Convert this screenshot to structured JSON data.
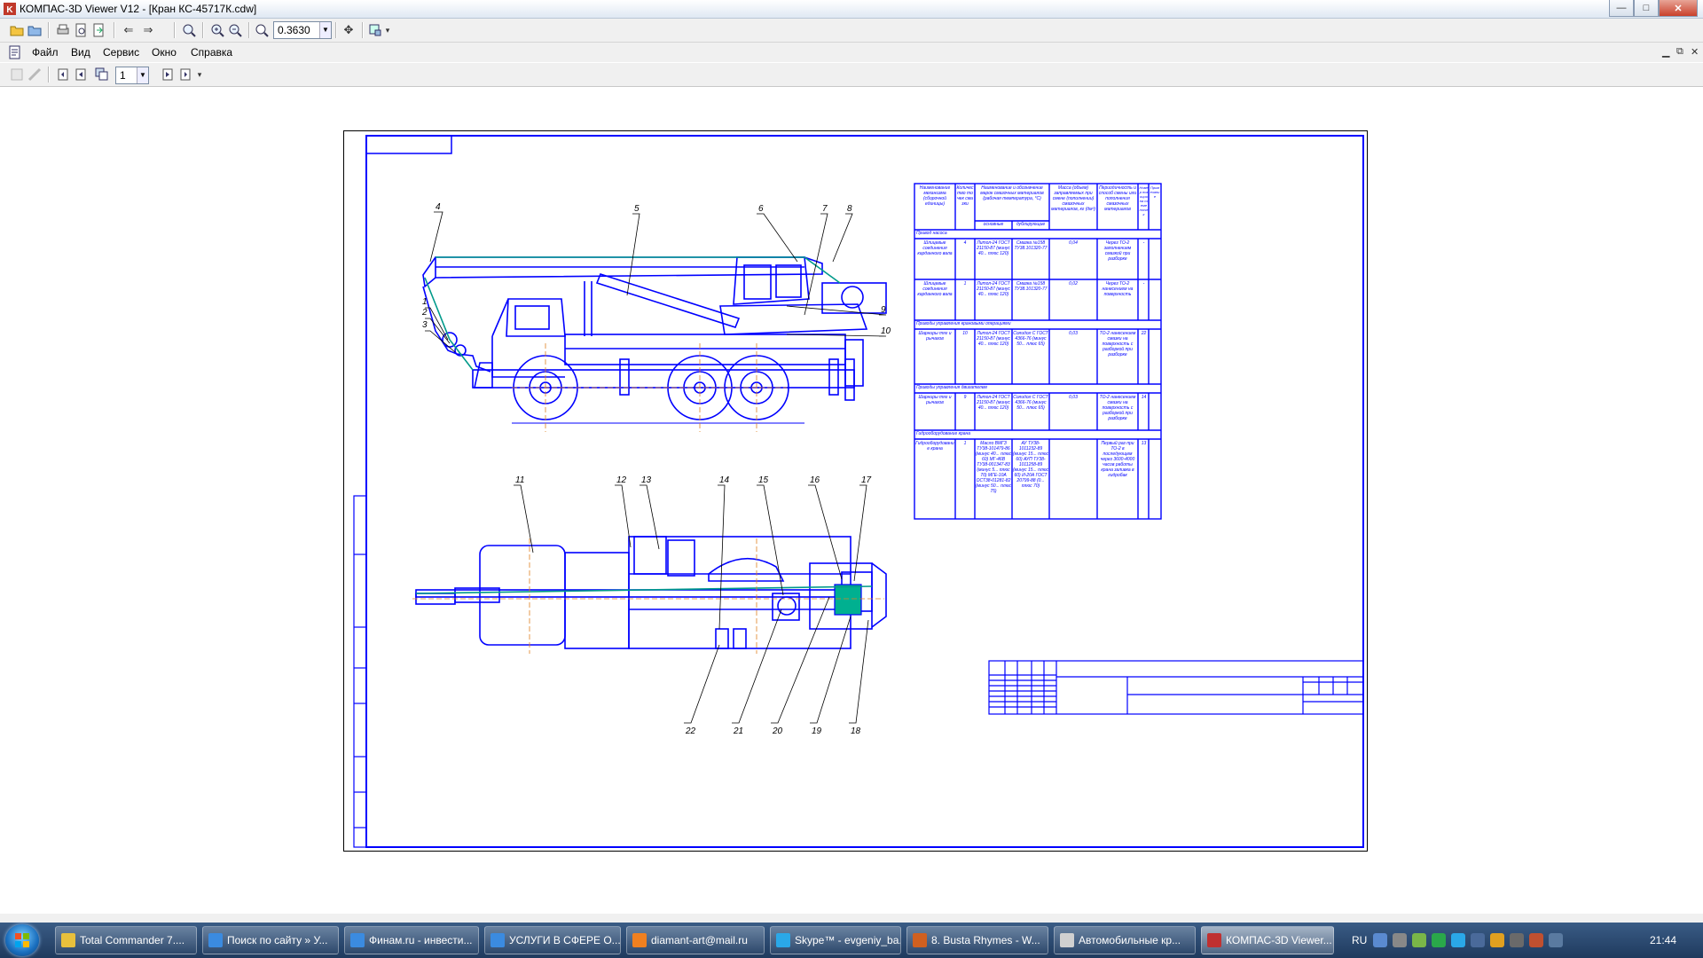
{
  "window": {
    "title": "КОМПАС-3D Viewer V12 - [Кран КС-45717К.cdw]"
  },
  "toolbar": {
    "zoom_value": "0.3630",
    "icons": [
      "open-icon",
      "open-folder-icon",
      "print-icon",
      "print-preview-icon",
      "export-icon",
      "back-arrow-icon",
      "forward-arrow-icon",
      "zoom-window-icon",
      "zoom-in-icon",
      "zoom-out-icon",
      "zoom-scale-icon",
      "pan-icon",
      "refresh-icon"
    ]
  },
  "menu": {
    "items": [
      "Файл",
      "Вид",
      "Сервис",
      "Окно",
      "Справка"
    ]
  },
  "toolbar2": {
    "page_value": "1"
  },
  "drawing": {
    "callouts_top": [
      "1",
      "2",
      "3",
      "4",
      "5",
      "6",
      "7",
      "8",
      "9",
      "10"
    ],
    "callouts_bottom": [
      "11",
      "12",
      "13",
      "14",
      "15",
      "16",
      "17",
      "18",
      "19",
      "20",
      "21",
      "22"
    ],
    "table": {
      "headers": [
        "Наименование механизма (сборочной единицы)",
        "Количество точек смазки",
        "Наименование и обозначение марок смазочных материалов (рабочая температура, °С)",
        "Масса (объем) заправляемых при смене (пополнении) смазочных материалов, кг (дм³)",
        "Периодичность и способ смены или пополнения смазочных материалов",
        "Номер позиции на схеме точек",
        "Примечание"
      ],
      "subheaders": [
        "основные",
        "дублирующие"
      ],
      "sections": [
        {
          "title": "Привод насоса",
          "rows": [
            {
              "name": "Шлицевые соединения карданного вала",
              "points": "4",
              "main": "Литол-24 ГОСТ 21150-87 (минус 40... плюс 120)",
              "dup": "Смазка №158 ТУ38.101320-77",
              "mass": "0,04",
              "period": "Через ТО-2 заполнением смазкой при разборке",
              "pos": "-"
            },
            {
              "name": "Шлицевые соединения карданного вала",
              "points": "1",
              "main": "Литол-24 ГОСТ 21150-87 (минус 40... плюс 120)",
              "dup": "Смазка №158 ТУ38.101320-77",
              "mass": "0,02",
              "period": "Через ТО-2 нанесением на поверхность",
              "pos": "-"
            }
          ]
        },
        {
          "title": "Приводы управления крановыми операциями",
          "rows": [
            {
              "name": "Шарниры тяг и рычагов",
              "points": "10",
              "main": "Литол-24 ГОСТ 21150-87 (минус 40... плюс 120)",
              "dup": "Солидол С ГОСТ 4366-76 (минус 50... плюс 65)",
              "mass": "0,03",
              "period": "ТО-2 нанесением смазки на поверхность с разборкой при разборке",
              "pos": "22"
            }
          ]
        },
        {
          "title": "Приводы управления двигателем",
          "rows": [
            {
              "name": "Шарниры тяг и рычагов",
              "points": "9",
              "main": "Литол-24 ГОСТ 21150-87 (минус 40... плюс 120)",
              "dup": "Солидол С ГОСТ 4366-76 (минус 50... плюс 65)",
              "mass": "0,03",
              "period": "ТО-2 нанесением смазки на поверхность с разборкой при разборке",
              "pos": "14"
            }
          ]
        },
        {
          "title": "Гидрооборудование крана",
          "rows": [
            {
              "name": "Гидрооборудование крана",
              "points": "1",
              "main": "Масло ВМГЗ ТУ38-101479-86 (минус 40... плюс 60) МГ-46В ТУ38-001347-83 (минус 5... плюс 70) МГЕ-10А ОСТ38-01281-82 (минус 50... плюс 75)",
              "dup": "АУ ТУ38-1011232-89 (минус 15... плюс 60) АУП ТУ38-1011258-89 (минус 15... плюс 60) И-20А ГОСТ 20799-88 (0... плюс 70)",
              "mass": "",
              "period": "Первый раз при ТО-2 в последующем через 3600-4000 часов работы крана заливка в гидробак",
              "pos": "13"
            }
          ]
        }
      ]
    }
  },
  "taskbar": {
    "items": [
      {
        "label": "Total Commander 7....",
        "color": "#e8c03c"
      },
      {
        "label": "Поиск по сайту » У...",
        "color": "#3b8be0"
      },
      {
        "label": "Финам.ru - инвести...",
        "color": "#3b8be0"
      },
      {
        "label": "УСЛУГИ В СФЕРЕ О...",
        "color": "#3b8be0"
      },
      {
        "label": "diamant-art@mail.ru",
        "color": "#f08020"
      },
      {
        "label": "Skype™ - evgeniy_ba...",
        "color": "#2aa8e8"
      },
      {
        "label": "8. Busta Rhymes - W...",
        "color": "#d06020"
      },
      {
        "label": "Автомобильные кр...",
        "color": "#d0d0d0"
      },
      {
        "label": "КОМПАС-3D Viewer...",
        "color": "#c03030"
      }
    ],
    "lang": "RU",
    "clock": "21:44"
  }
}
